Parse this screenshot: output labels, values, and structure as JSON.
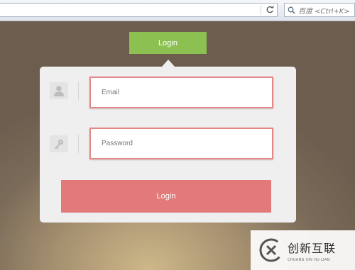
{
  "browser": {
    "search_placeholder": "百度 <Ctrl+K>",
    "refresh_icon": "refresh-icon",
    "search_icon": "search-icon"
  },
  "header": {
    "login_tab_label": "Login"
  },
  "form": {
    "email_placeholder": "Email",
    "password_placeholder": "Password",
    "submit_label": "Login",
    "email_icon": "user-icon",
    "password_icon": "key-icon"
  },
  "watermark": {
    "cn_text": "创新互联",
    "en_text": "CHUANG XIN HU LIAN"
  },
  "colors": {
    "login_tab": "#8cc152",
    "submit_button": "#e27a79",
    "input_border": "#e28786",
    "card_background": "#efefef"
  }
}
